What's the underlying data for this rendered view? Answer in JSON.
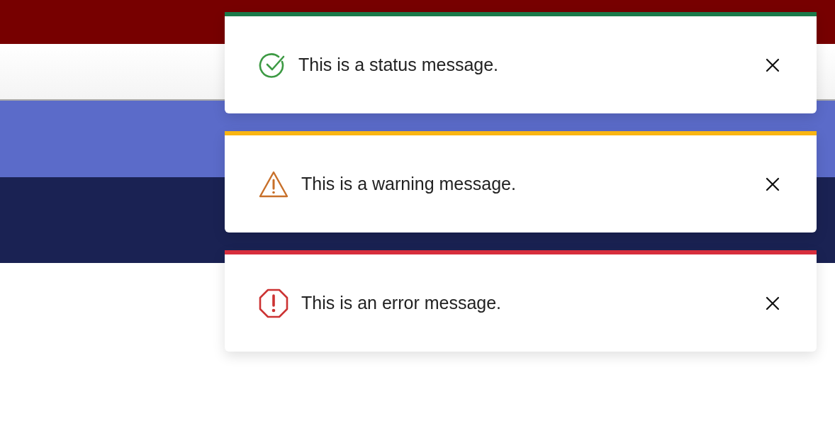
{
  "messages": [
    {
      "kind": "status",
      "text": "This is a status message."
    },
    {
      "kind": "warning",
      "text": "This is a warning message."
    },
    {
      "kind": "error",
      "text": "This is an error message."
    }
  ]
}
